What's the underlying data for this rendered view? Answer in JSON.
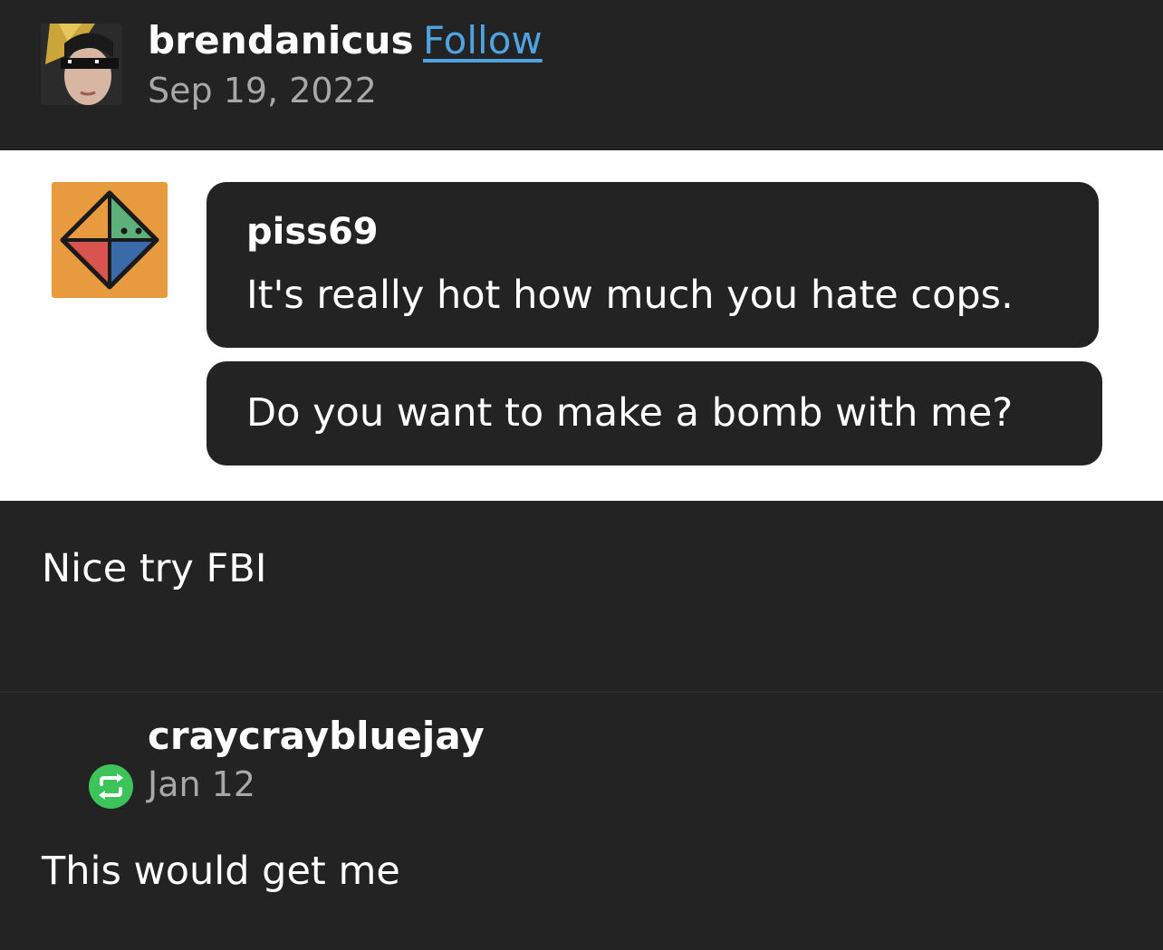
{
  "post": {
    "username": "brendanicus",
    "follow_label": "Follow",
    "date": "Sep 19, 2022"
  },
  "ask": {
    "asker": "piss69",
    "line1": "It's really hot how much you hate cops.",
    "line2": "Do you want to make a bomb with me?"
  },
  "answer": {
    "text": "Nice try FBI"
  },
  "reblog": {
    "username": "craycraybluejay",
    "date": "Jan 12",
    "text": "This would get me"
  },
  "colors": {
    "background": "#232323",
    "follow_link": "#4fa3e0",
    "reblog_icon": "#3cc45a",
    "asker_avatar_bg": "#e89a3e"
  }
}
